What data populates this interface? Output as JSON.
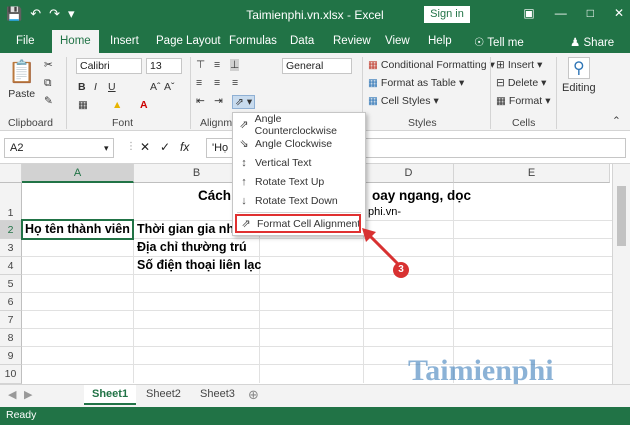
{
  "titlebar": {
    "title": "Taimienphi.vn.xlsx  -  Excel",
    "signin": "Sign in",
    "qat_icons": [
      "save-icon",
      "undo-icon",
      "redo-icon",
      "customize-icon"
    ]
  },
  "tabs": [
    {
      "label": "File"
    },
    {
      "label": "Home"
    },
    {
      "label": "Insert"
    },
    {
      "label": "Page Layout"
    },
    {
      "label": "Formulas"
    },
    {
      "label": "Data"
    },
    {
      "label": "Review"
    },
    {
      "label": "View"
    },
    {
      "label": "Help"
    }
  ],
  "tellme": "Tell me",
  "share": "Share",
  "ribbon": {
    "paste": "Paste",
    "clipboard": "Clipboard",
    "font_name": "Calibri",
    "font_size": "13",
    "font": "Font",
    "align": "Alignm",
    "number_format": "General",
    "cond_format": "Conditional Formatting",
    "format_table": "Format as Table",
    "cell_styles": "Cell Styles",
    "styles": "Styles",
    "insert": "Insert",
    "delete": "Delete",
    "format": "Format",
    "cells": "Cells",
    "editing": "Editing"
  },
  "formula": {
    "namebox": "A2",
    "value": "'Họ"
  },
  "columns": [
    "A",
    "B",
    "C",
    "D",
    "E"
  ],
  "rows": [
    "1",
    "2",
    "3",
    "4",
    "5",
    "6",
    "7",
    "8",
    "9",
    "10"
  ],
  "cells": {
    "c1_left": "Cách",
    "c1_right": "oay ngang, dọc",
    "d1_sub": "phi.vn-",
    "a2": "Họ tên thành viên",
    "b2": "Thời gian gia nhập",
    "b3": "Địa chỉ thường trú",
    "b4": "Số điện thoại liên lạc"
  },
  "menu": [
    {
      "label": "Angle Counterclockwise",
      "icon": "angle-ccw-icon"
    },
    {
      "label": "Angle Clockwise",
      "icon": "angle-cw-icon"
    },
    {
      "label": "Vertical Text",
      "icon": "vertical-text-icon"
    },
    {
      "label": "Rotate Text Up",
      "icon": "rotate-up-icon"
    },
    {
      "label": "Rotate Text Down",
      "icon": "rotate-down-icon"
    },
    {
      "label": "Format Cell Alignment",
      "icon": "format-align-icon"
    }
  ],
  "step_badge": "3",
  "sheets": [
    {
      "label": "Sheet1"
    },
    {
      "label": "Sheet2"
    },
    {
      "label": "Sheet3"
    }
  ],
  "status": "Ready",
  "watermark": "Taimienphi",
  "colors": {
    "accent": "#217346",
    "highlight": "#e03030"
  }
}
